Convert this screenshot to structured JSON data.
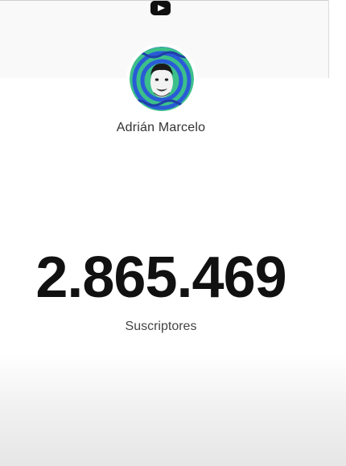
{
  "header": {
    "icon": "youtube-icon"
  },
  "channel": {
    "name": "Adrián Marcelo",
    "avatar_icon": "channel-avatar"
  },
  "stats": {
    "subscriber_count": "2.865.469",
    "subscriber_label": "Suscriptores"
  },
  "colors": {
    "accent": "#0f0f0f",
    "avatar_green": "#3cc08a",
    "avatar_blue": "#2a5bd7"
  }
}
